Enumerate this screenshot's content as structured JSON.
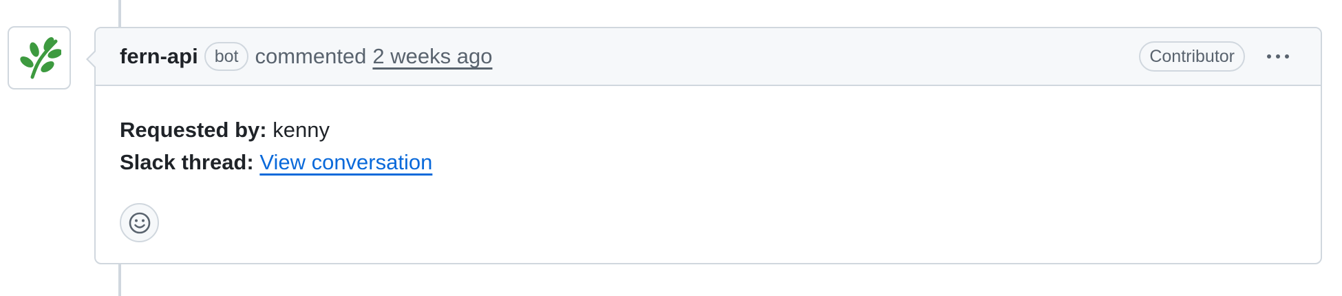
{
  "comment": {
    "author": "fern-api",
    "bot_badge": "bot",
    "action": "commented",
    "timestamp": "2 weeks ago",
    "role_badge": "Contributor",
    "body": {
      "requested_by_label": "Requested by:",
      "requested_by_value": "kenny",
      "slack_thread_label": "Slack thread:",
      "slack_thread_link": "View conversation"
    }
  },
  "colors": {
    "avatar_leaf": "#3d9a3f",
    "link": "#0969da",
    "border": "#d0d7de",
    "header_bg": "#f6f8fa"
  },
  "icons": {
    "avatar": "fern-leaf-icon",
    "more": "kebab-horizontal-icon",
    "reaction": "smiley-icon"
  }
}
